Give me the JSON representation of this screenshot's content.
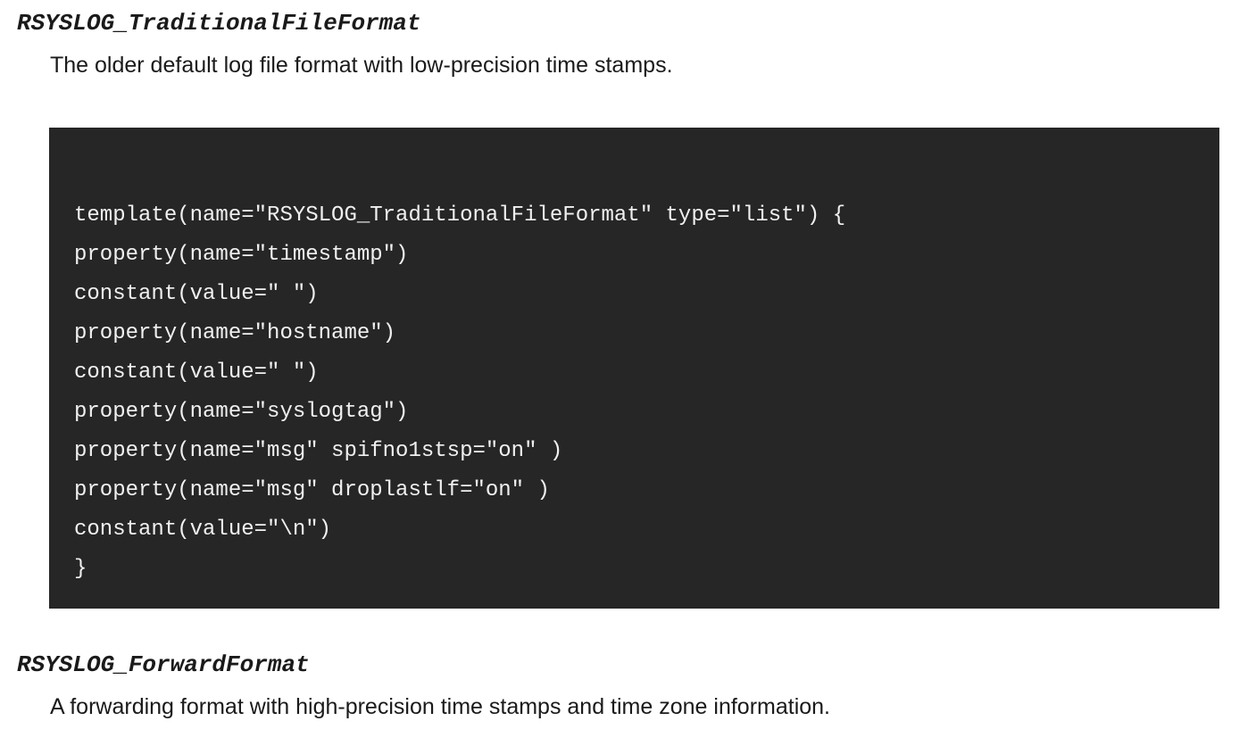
{
  "sections": [
    {
      "term": "RSYSLOG_TraditionalFileFormat",
      "description": "The older default log file format with low-precision time stamps.",
      "code_lines": [
        "template(name=\"RSYSLOG_TraditionalFileFormat\" type=\"list\") {",
        "property(name=\"timestamp\")",
        "constant(value=\" \")",
        "property(name=\"hostname\")",
        "constant(value=\" \")",
        "property(name=\"syslogtag\")",
        "property(name=\"msg\" spifno1stsp=\"on\" )",
        "property(name=\"msg\" droplastlf=\"on\" )",
        "constant(value=\"\\n\")",
        "}"
      ]
    },
    {
      "term": "RSYSLOG_ForwardFormat",
      "description": "A forwarding format with high-precision time stamps and time zone information."
    }
  ],
  "colors": {
    "code_background": "#262626",
    "code_text": "#f0f0f0",
    "body_text": "#1a1a1a"
  }
}
